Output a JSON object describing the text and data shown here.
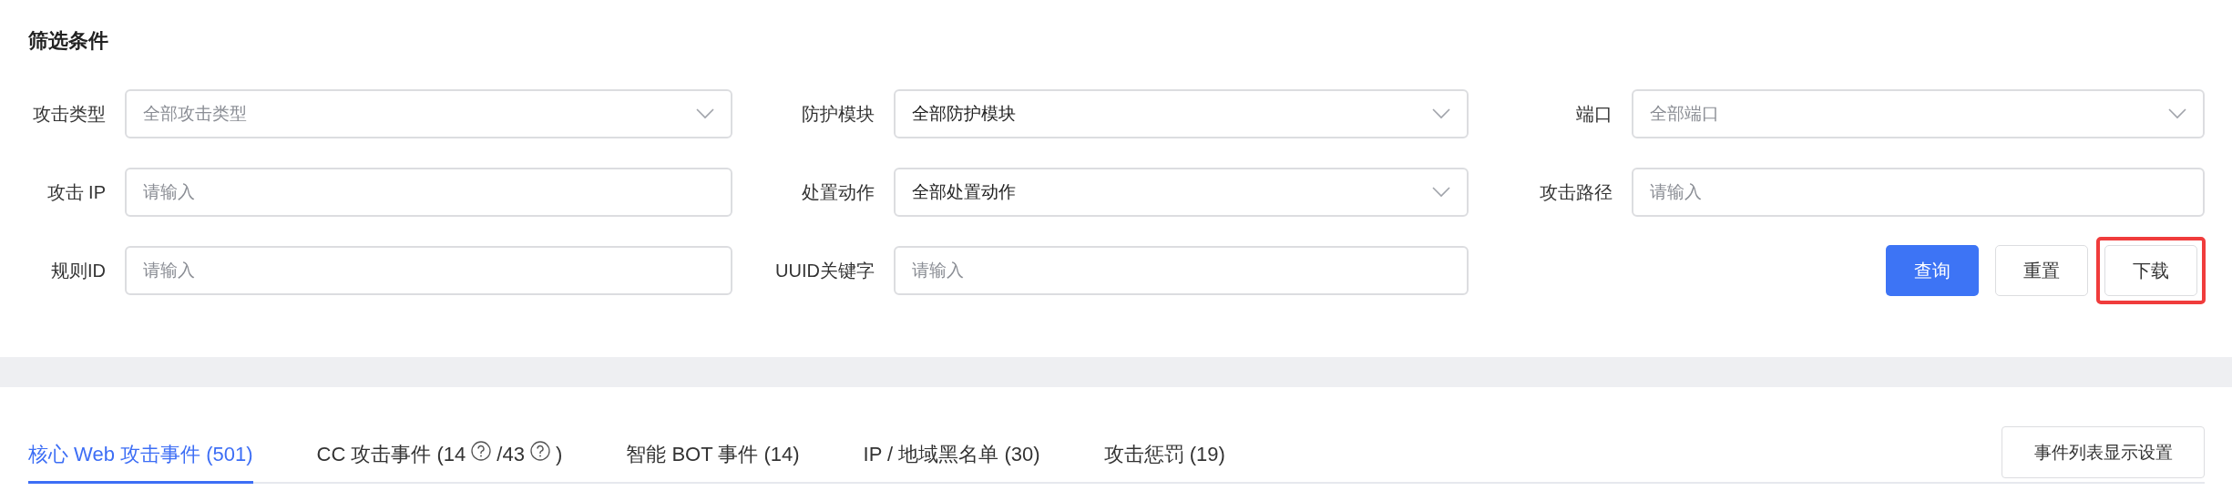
{
  "filter_panel": {
    "title": "筛选条件",
    "fields": [
      {
        "label": "攻击类型",
        "kind": "select",
        "placeholder": "全部攻击类型"
      },
      {
        "label": "防护模块",
        "kind": "select",
        "value": "全部防护模块"
      },
      {
        "label": "端口",
        "kind": "select",
        "placeholder": "全部端口"
      },
      {
        "label": "攻击 IP",
        "kind": "input",
        "placeholder": "请输入"
      },
      {
        "label": "处置动作",
        "kind": "select",
        "value": "全部处置动作"
      },
      {
        "label": "攻击路径",
        "kind": "input",
        "placeholder": "请输入"
      },
      {
        "label": "规则ID",
        "kind": "input",
        "placeholder": "请输入"
      },
      {
        "label": "UUID关键字",
        "kind": "input",
        "placeholder": "请输入"
      }
    ],
    "buttons": [
      {
        "label": "查询",
        "kind": "primary",
        "highlighted": false
      },
      {
        "label": "重置",
        "kind": "default",
        "highlighted": false
      },
      {
        "label": "下载",
        "kind": "default",
        "highlighted": true
      }
    ]
  },
  "tabs": [
    {
      "selected": true,
      "parts": [
        {
          "kind": "text",
          "text": "核心 Web 攻击事件 (501)"
        }
      ]
    },
    {
      "selected": false,
      "parts": [
        {
          "kind": "text",
          "text": "CC 攻击事件 (14"
        },
        {
          "kind": "help"
        },
        {
          "kind": "text",
          "text": "/43"
        },
        {
          "kind": "help"
        },
        {
          "kind": "text",
          "text": ")"
        }
      ]
    },
    {
      "selected": false,
      "parts": [
        {
          "kind": "text",
          "text": "智能 BOT 事件 (14)"
        }
      ]
    },
    {
      "selected": false,
      "parts": [
        {
          "kind": "text",
          "text": "IP / 地域黑名单 (30)"
        }
      ]
    },
    {
      "selected": false,
      "parts": [
        {
          "kind": "text",
          "text": "攻击惩罚 (19)"
        }
      ]
    }
  ],
  "settings_button": {
    "label": "事件列表显示设置"
  }
}
